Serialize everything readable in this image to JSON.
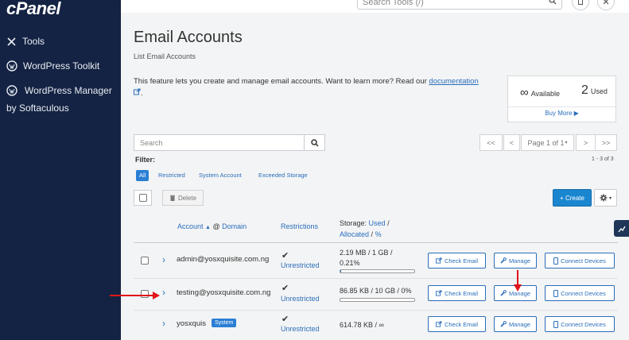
{
  "sidebar": {
    "logo": "cPanel",
    "items": [
      {
        "label": "Tools",
        "icon": "tools-icon"
      },
      {
        "label": "WordPress Toolkit",
        "icon": "wordpress-icon"
      },
      {
        "label": "WordPress Manager",
        "icon": "wordpress-icon"
      }
    ],
    "item3_sub": "by Softaculous"
  },
  "topbar": {
    "search_placeholder": "Search Tools (/)"
  },
  "page": {
    "title": "Email Accounts",
    "subtitle": "List Email Accounts",
    "description": "This feature lets you create and manage email accounts. Want to learn more? Read our ",
    "doc_link": "documentation",
    "desc_tail": "."
  },
  "stats": {
    "available_symbol": "∞",
    "available_label": "Available",
    "used_value": "2",
    "used_label": "Used",
    "buy_more": "Buy More"
  },
  "search": {
    "placeholder": "Search"
  },
  "pagination": {
    "first": "<<",
    "prev": "<",
    "page_label": "Page 1 of 1",
    "next": ">",
    "last": ">>",
    "count": "1 - 3 of 3"
  },
  "filter": {
    "label": "Filter:",
    "options": [
      "All",
      "Restricted",
      "System Account",
      "Exceeded Storage"
    ],
    "active": "All"
  },
  "toolbar": {
    "delete_label": "Delete",
    "create_label": "+ Create"
  },
  "table": {
    "headers": {
      "account": "Account",
      "at": "@",
      "domain": "Domain",
      "restrictions": "Restrictions",
      "storage_prefix": "Storage:",
      "used": "Used",
      "slash1": "/",
      "allocated": "Allocated",
      "slash2": "/",
      "percent": "%"
    },
    "actions": {
      "check_email": "Check Email",
      "manage": "Manage",
      "connect_devices": "Connect Devices"
    },
    "rows": [
      {
        "account": "admin@yosxquisite.com.ng",
        "restriction": "Unrestricted",
        "storage_line1": "2.19 MB / 1 GB /",
        "storage_line2": "0.21%",
        "usage_fraction": 0.0021
      },
      {
        "account": "testing@yosxquisite.com.ng",
        "restriction": "Unrestricted",
        "storage_line1": "86.85 KB / 10 GB / 0%",
        "storage_line2": "",
        "usage_fraction": 0.0
      },
      {
        "account": "yosxquis",
        "badge": "System",
        "restriction": "Unrestricted",
        "storage_line1": "614.78 KB / ∞",
        "storage_line2": ""
      }
    ]
  },
  "colors": {
    "sidebar_bg": "#142343",
    "accent": "#2a7fd4",
    "annotation_arrow": "#e0141a"
  }
}
